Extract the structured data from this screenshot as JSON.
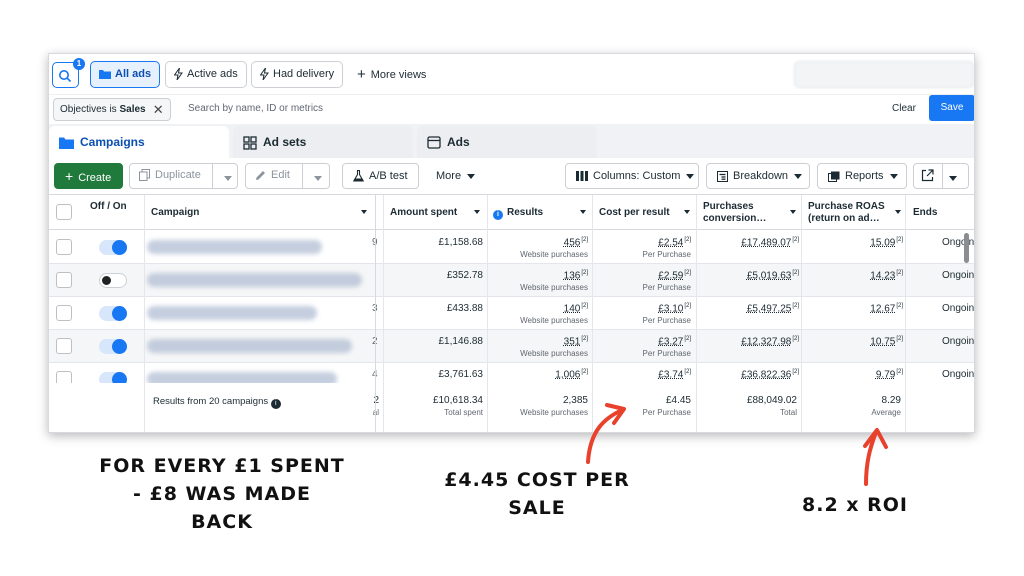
{
  "toolbar": {
    "notification_count": "1",
    "all_ads": "All ads",
    "active_ads": "Active ads",
    "had_delivery": "Had delivery",
    "more_views": "More views"
  },
  "filter_bar": {
    "filter_prefix": "Objectives is",
    "filter_value": "Sales",
    "search_placeholder": "Search by name, ID or metrics",
    "clear_label": "Clear",
    "save_label": "Save"
  },
  "tabs": [
    {
      "label": "Campaigns",
      "icon": "folder-icon"
    },
    {
      "label": "Ad sets",
      "icon": "grid-icon"
    },
    {
      "label": "Ads",
      "icon": "ad-icon"
    }
  ],
  "actions": {
    "create": "Create",
    "duplicate": "Duplicate",
    "edit": "Edit",
    "ab_test": "A/B test",
    "more": "More",
    "columns": "Columns: Custom",
    "breakdown": "Breakdown",
    "reports": "Reports"
  },
  "columns": {
    "off_on": "Off / On",
    "campaign": "Campaign",
    "amount_spent": "Amount spent",
    "results": "Results",
    "cost_per_result": "Cost per result",
    "purchases_conversion_1": "Purchases",
    "purchases_conversion_2": "conversion…",
    "purchase_roas_1": "Purchase ROAS",
    "purchase_roas_2": "(return on ad…",
    "ends": "Ends"
  },
  "rows": [
    {
      "toggle": "on",
      "cut": "9",
      "amount": "£1,158.68",
      "results": "456",
      "results_sub": "Website purchases",
      "cpr": "£2.54",
      "cpr_sub": "Per Purchase",
      "conv": "£17,489.07",
      "roas": "15.09",
      "ends": "Ongoin"
    },
    {
      "toggle": "off",
      "cut": "",
      "amount": "£352.78",
      "results": "136",
      "results_sub": "Website purchases",
      "cpr": "£2.59",
      "cpr_sub": "Per Purchase",
      "conv": "£5,019.63",
      "roas": "14.23",
      "ends": "Ongoin"
    },
    {
      "toggle": "on",
      "cut": "3",
      "amount": "£433.88",
      "results": "140",
      "results_sub": "Website purchases",
      "cpr": "£3.10",
      "cpr_sub": "Per Purchase",
      "conv": "£5,497.25",
      "roas": "12.67",
      "ends": "Ongoin"
    },
    {
      "toggle": "on",
      "cut": "2",
      "amount": "£1,146.88",
      "results": "351",
      "results_sub": "Website purchases",
      "cpr": "£3.27",
      "cpr_sub": "Per Purchase",
      "conv": "£12,327.98",
      "roas": "10.75",
      "ends": "Ongoin"
    },
    {
      "toggle": "on",
      "cut": "4",
      "amount": "£3,761.63",
      "results": "1,006",
      "results_sub": "Website purchases",
      "cpr": "£3.74",
      "cpr_sub": "Per Purchase",
      "conv": "£36,822.36",
      "roas": "9.79",
      "ends": "Ongoin"
    }
  ],
  "footnote_mark": "[2]",
  "summary": {
    "label": "Results from 20 campaigns",
    "cut": "2",
    "cut_sub": "al",
    "amount": "£10,618.34",
    "amount_sub": "Total spent",
    "results": "2,385",
    "results_sub": "Website purchases",
    "cpr": "£4.45",
    "cpr_sub": "Per Purchase",
    "conv": "£88,049.02",
    "conv_sub": "Total",
    "roas": "8.29",
    "roas_sub": "Average"
  },
  "annotations": {
    "left_1": "FOR EVERY £1 SPENT",
    "left_2": "- £8 WAS MADE",
    "left_3": "BACK",
    "mid_1": "£4.45 COST PER",
    "mid_2": "SALE",
    "right": "8.2 x ROI"
  },
  "colors": {
    "accent": "#1877f2",
    "create_green": "#1f7a3c",
    "arrow_red": "#e8412c"
  }
}
